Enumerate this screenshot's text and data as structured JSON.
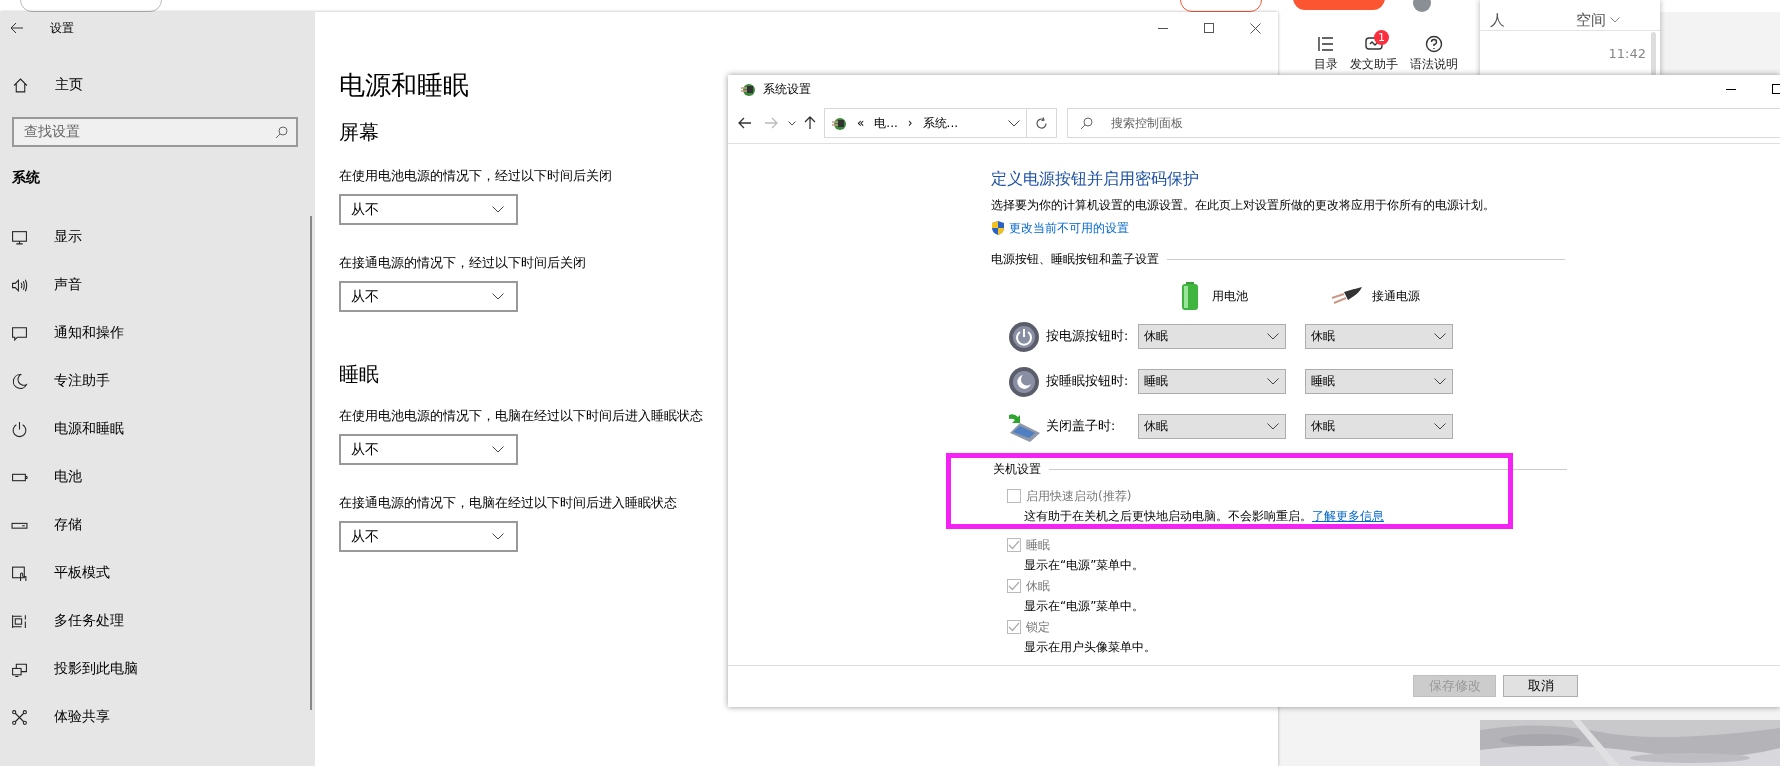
{
  "editor_toolbar": {
    "items": [
      {
        "label": "目录",
        "kind": "outline"
      },
      {
        "label": "发文助手",
        "kind": "assistant",
        "badge": "1"
      },
      {
        "label": "语法说明",
        "kind": "help"
      }
    ]
  },
  "chat_panel": {
    "tabs": [
      "人",
      "空间"
    ],
    "time": "11:42"
  },
  "settings": {
    "title": "设置",
    "home": "主页",
    "search": {
      "placeholder": "查找设置"
    },
    "section": "系统",
    "nav": [
      {
        "label": "显示",
        "kind": "display"
      },
      {
        "label": "声音",
        "kind": "sound"
      },
      {
        "label": "通知和操作",
        "kind": "notification"
      },
      {
        "label": "专注助手",
        "kind": "focus"
      },
      {
        "label": "电源和睡眠",
        "kind": "power"
      },
      {
        "label": "电池",
        "kind": "battery"
      },
      {
        "label": "存储",
        "kind": "storage"
      },
      {
        "label": "平板模式",
        "kind": "tablet"
      },
      {
        "label": "多任务处理",
        "kind": "multitask"
      },
      {
        "label": "投影到此电脑",
        "kind": "project"
      },
      {
        "label": "体验共享",
        "kind": "share"
      }
    ],
    "page_title": "电源和睡眠",
    "groups": [
      {
        "heading": "屏幕",
        "fields": [
          {
            "label": "在使用电池电源的情况下，经过以下时间后关闭",
            "value": "从不"
          },
          {
            "label": "在接通电源的情况下，经过以下时间后关闭",
            "value": "从不"
          }
        ]
      },
      {
        "heading": "睡眠",
        "fields": [
          {
            "label": "在使用电池电源的情况下，电脑在经过以下时间后进入睡眠状态",
            "value": "从不"
          },
          {
            "label": "在接通电源的情况下，电脑在经过以下时间后进入睡眠状态",
            "value": "从不"
          }
        ]
      }
    ]
  },
  "control_panel": {
    "title": "系统设置",
    "breadcrumb": {
      "overflow": "«",
      "items": [
        "电...",
        "系统..."
      ],
      "separator": "›"
    },
    "search": {
      "placeholder": "搜索控制面板"
    },
    "heading": "定义电源按钮并启用密码保护",
    "description": "选择要为你的计算机设置的电源设置。在此页上对设置所做的更改将应用于你所有的电源计划。",
    "admin_link": "更改当前不可用的设置",
    "button_section": "电源按钮、睡眠按钮和盖子设置",
    "columns": [
      {
        "label": "用电池",
        "kind": "battery"
      },
      {
        "label": "接通电源",
        "kind": "plug"
      }
    ],
    "rows": [
      {
        "label": "按电源按钮时:",
        "kind": "power",
        "values": [
          "休眠",
          "休眠"
        ]
      },
      {
        "label": "按睡眠按钮时:",
        "kind": "sleep",
        "values": [
          "睡眠",
          "睡眠"
        ]
      },
      {
        "label": "关闭盖子时:",
        "kind": "lid",
        "values": [
          "休眠",
          "休眠"
        ]
      }
    ],
    "shutdown_section": "关机设置",
    "shutdown_options": [
      {
        "label": "启用快速启动(推荐)",
        "checked": false,
        "disabled": true,
        "description": "这有助于在关机之后更快地启动电脑。不会影响重启。",
        "link": "了解更多信息"
      },
      {
        "label": "睡眠",
        "checked": true,
        "disabled": true,
        "description": "显示在“电源”菜单中。"
      },
      {
        "label": "休眠",
        "checked": true,
        "disabled": true,
        "description": "显示在“电源”菜单中。"
      },
      {
        "label": "锁定",
        "checked": true,
        "disabled": true,
        "description": "显示在用户头像菜单中。"
      }
    ],
    "buttons": [
      {
        "label": "保存修改",
        "disabled": true
      },
      {
        "label": "取消",
        "disabled": false
      }
    ]
  }
}
